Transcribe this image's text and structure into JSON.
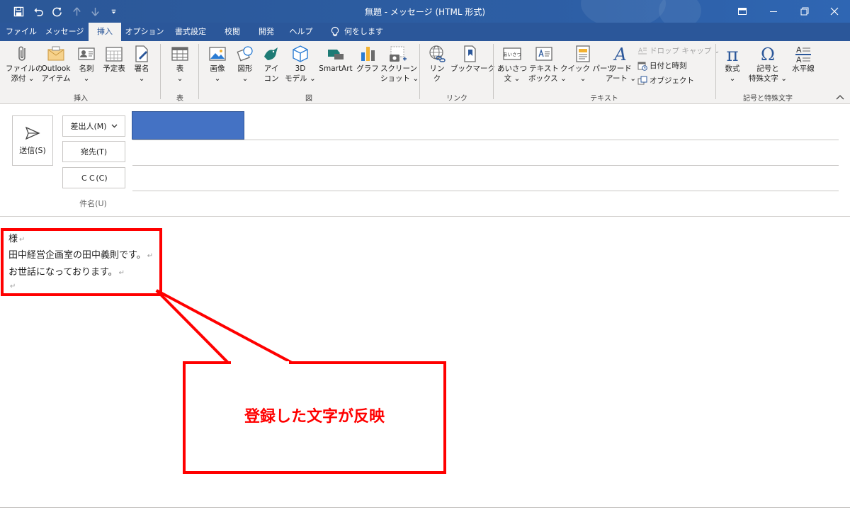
{
  "window": {
    "title": "無題 - メッセージ (HTML 形式)"
  },
  "menu": {
    "tabs": [
      "ファイル",
      "メッセージ",
      "挿入",
      "オプション",
      "書式設定",
      "校閲",
      "開発",
      "ヘルプ"
    ],
    "active_tab": "挿入",
    "tell_me": "何をしますか"
  },
  "ribbon": {
    "groups": {
      "insert": "挿入",
      "table": "表",
      "illustrations": "図",
      "links": "リンク",
      "text": "テキスト",
      "symbols": "記号と特殊文字"
    },
    "buttons": {
      "attach_file": [
        "ファイルの",
        "添付 ⌄"
      ],
      "outlook_item": [
        "Outlook",
        "アイテム"
      ],
      "business_card": [
        "名刺",
        "⌄"
      ],
      "calendar": [
        "予定表",
        ""
      ],
      "signature": [
        "署名",
        "⌄"
      ],
      "table": [
        "表",
        "⌄"
      ],
      "pictures": [
        "画像",
        "⌄"
      ],
      "shapes": [
        "図形",
        "⌄"
      ],
      "icons": [
        "アイ",
        "コン"
      ],
      "models_3d": [
        "3D",
        "モデル ⌄"
      ],
      "smartart": [
        "SmartArt",
        ""
      ],
      "chart": [
        "グラフ",
        ""
      ],
      "screenshot": [
        "スクリーン",
        "ショット ⌄"
      ],
      "link": [
        "リン",
        "ク"
      ],
      "bookmark": [
        "ブックマーク",
        ""
      ],
      "greeting": [
        "あいさつ",
        "文 ⌄"
      ],
      "text_box": [
        "テキスト",
        "ボックス ⌄"
      ],
      "quick_parts": [
        "クイック パーツ",
        "⌄"
      ],
      "wordart": [
        "ワード",
        "アート ⌄"
      ],
      "equation": [
        "数式",
        "⌄"
      ],
      "symbol": [
        "記号と",
        "特殊文字 ⌄"
      ],
      "horizontal_line": [
        "水平線",
        ""
      ]
    },
    "small": {
      "drop_cap": "ドロップ キャップ ⌄",
      "date_time": "日付と時刻",
      "object": "オブジェクト"
    },
    "icon_text": {
      "greeting": "あいさつ",
      "pi": "π",
      "omega": "Ω",
      "wordart": "A"
    }
  },
  "compose": {
    "send": "送信(S)",
    "from": "差出人(M)",
    "to": "宛先(T)",
    "cc": "ＣＣ(C)",
    "subject": "件名(U)"
  },
  "body": {
    "lines": [
      "様",
      "田中経営企画室の田中義則です。",
      "お世話になっております。",
      ""
    ],
    "para_mark": "↵"
  },
  "annotation": {
    "text": "登録した文字が反映",
    "color": "#ff0000"
  },
  "colors": {
    "accent": "#2b579a",
    "ribbon_bg": "#f3f2f1",
    "from_fill": "#4472c4"
  }
}
